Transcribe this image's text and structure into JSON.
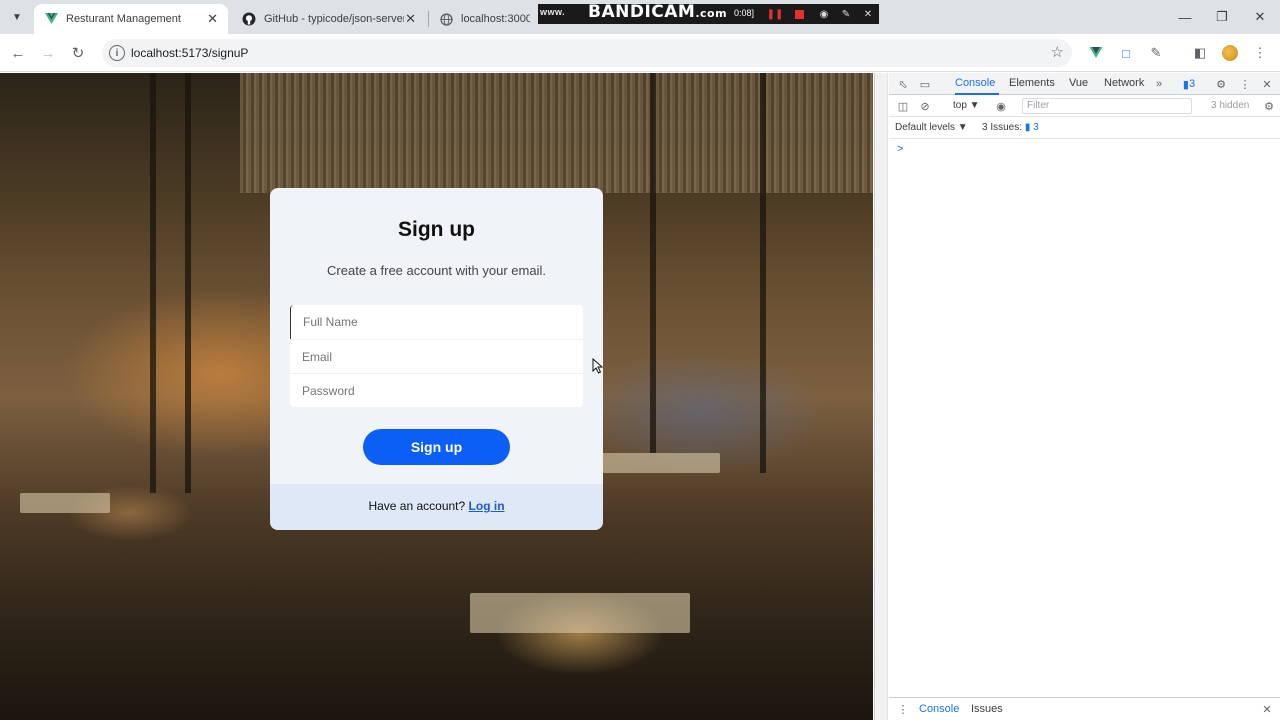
{
  "browser": {
    "tabs": [
      {
        "title": "Resturant Management",
        "favicon": "vue-icon",
        "active": true
      },
      {
        "title": "GitHub - typicode/json-server: ...",
        "favicon": "github-icon",
        "active": false
      },
      {
        "title": "localhost:3000/item",
        "favicon": "globe-icon",
        "active": false
      }
    ],
    "url": "localhost:5173/signuP"
  },
  "recorder": {
    "url": "www.",
    "logo": "BANDICAM",
    "suffix": ".com",
    "time": "0:08]"
  },
  "signup": {
    "title": "Sign up",
    "subtitle": "Create a free account with your email.",
    "fullname_placeholder": "Full Name",
    "email_placeholder": "Email",
    "password_placeholder": "Password",
    "submit_label": "Sign up",
    "footer_text": "Have an account?",
    "login_label": "Log in"
  },
  "devtools": {
    "tabs": [
      "Console",
      "Elements",
      "Vue",
      "Network"
    ],
    "issues_badge": "3",
    "context": "top",
    "filter_placeholder": "Filter",
    "hidden": "3 hidden",
    "levels": "Default levels",
    "issues_label": "3 Issues:",
    "issues_count": "3",
    "prompt": ">",
    "drawer_tabs": [
      "Console",
      "Issues"
    ]
  },
  "colors": {
    "primary": "#0b5ff6",
    "card_bg": "#f0f4f9",
    "footer_bg": "#dfe8f6",
    "link": "#1a5ad6",
    "devtools_accent": "#1a73e8"
  }
}
